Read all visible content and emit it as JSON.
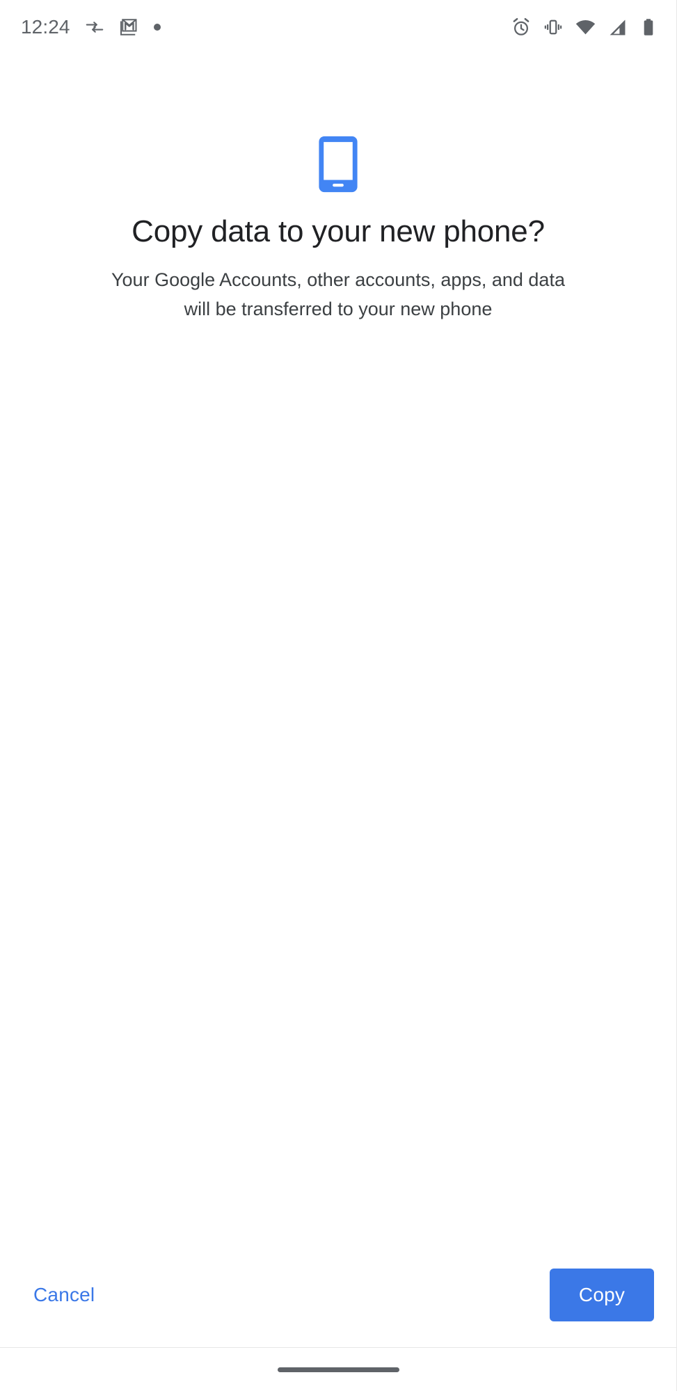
{
  "status_bar": {
    "clock": "12:24",
    "left_icons": [
      {
        "name": "data-transfer-icon",
        "label": "data transfer arrows"
      },
      {
        "name": "gmail-icon",
        "label": "Gmail notification"
      },
      {
        "name": "notification-dot-icon",
        "label": "notification dot"
      }
    ],
    "right_icons": [
      {
        "name": "alarm-icon",
        "label": "alarm set"
      },
      {
        "name": "vibrate-icon",
        "label": "ringer vibrate"
      },
      {
        "name": "wifi-icon",
        "label": "wifi full"
      },
      {
        "name": "cellular-signal-icon",
        "label": "cellular signal"
      },
      {
        "name": "battery-icon",
        "label": "battery full"
      }
    ]
  },
  "hero": {
    "icon": "smartphone-icon",
    "icon_color": "#4285f4"
  },
  "main": {
    "title": "Copy data to your new phone?",
    "subtitle": "Your Google Accounts, other accounts, apps, and data will be transferred to your new phone"
  },
  "actions": {
    "cancel_label": "Cancel",
    "copy_label": "Copy",
    "accent_color": "#3b78e7",
    "cancel_text_color": "#3b78e7"
  },
  "nav_bar": {
    "handle": "gesture-navigation-handle"
  },
  "colors": {
    "background": "#ffffff",
    "title_text": "#202124",
    "body_text": "#3c4043",
    "status_icon": "#5f6368"
  }
}
